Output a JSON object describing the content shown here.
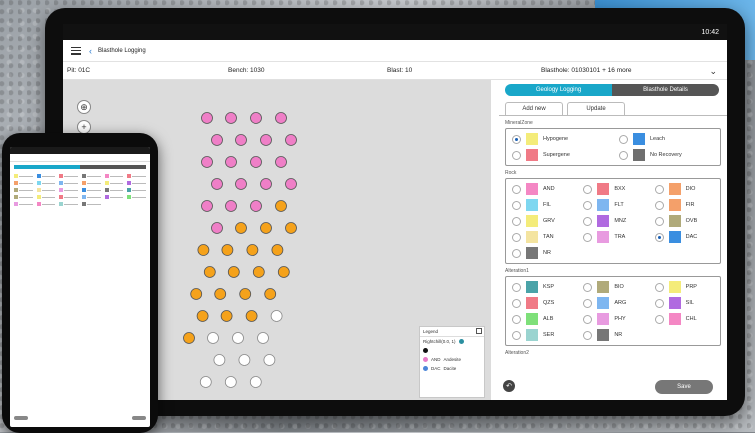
{
  "tablet": {
    "status_time": "10:42",
    "app_title": "Blasthole Logging",
    "info": {
      "pit": "Pit: 01C",
      "bench": "Bench: 1030",
      "blast": "Blast: 10",
      "blasthole": "Blasthole: 01030101 + 16 more"
    },
    "map": {
      "recenter_icon": "target-icon",
      "zoom_in_label": "+",
      "legend": {
        "title": "Legend",
        "subtitle": "Rightchill(0.0, 1)",
        "items": [
          {
            "code": "AND",
            "name": "Andesite",
            "color": "#e87bc8"
          },
          {
            "code": "DAC",
            "name": "Dacite",
            "color": "#4c86d8"
          }
        ]
      }
    },
    "panel": {
      "tabs_top": [
        "Geology Logging",
        "Blasthole Details"
      ],
      "tabs_sub": [
        "Add new",
        "Update"
      ],
      "mineralzone": {
        "label": "MineralZone",
        "options": [
          {
            "name": "Hypogene",
            "color": "#f4ec7a",
            "selected": true
          },
          {
            "name": "Leach",
            "color": "#3a8ee0",
            "selected": false
          },
          {
            "name": "Supergene",
            "color": "#f07a86",
            "selected": false
          },
          {
            "name": "No Recovery",
            "color": "#6f6f6f",
            "selected": false
          }
        ]
      },
      "rock": {
        "label": "Rock",
        "options": [
          {
            "name": "AND",
            "color": "#f487c4",
            "selected": false
          },
          {
            "name": "BXX",
            "color": "#f07a86",
            "selected": false
          },
          {
            "name": "DIO",
            "color": "#f4a06a",
            "selected": false
          },
          {
            "name": "FIL",
            "color": "#7ed7f0",
            "selected": false
          },
          {
            "name": "FLT",
            "color": "#7eb6f0",
            "selected": false
          },
          {
            "name": "FIR",
            "color": "#f4a06a",
            "selected": false
          },
          {
            "name": "GRV",
            "color": "#f4ec7a",
            "selected": false
          },
          {
            "name": "MNZ",
            "color": "#b06ae0",
            "selected": false
          },
          {
            "name": "OVB",
            "color": "#b0aa7a",
            "selected": false
          },
          {
            "name": "TAN",
            "color": "#f4e4a0",
            "selected": false
          },
          {
            "name": "TRA",
            "color": "#e89be0",
            "selected": false
          },
          {
            "name": "DAC",
            "color": "#3a8ee0",
            "selected": true
          },
          {
            "name": "NR",
            "color": "#777777",
            "selected": false
          }
        ]
      },
      "alteration1": {
        "label": "Alteration1",
        "options": [
          {
            "name": "KSP",
            "color": "#4aa3a8",
            "selected": false
          },
          {
            "name": "BIO",
            "color": "#b0aa7a",
            "selected": false
          },
          {
            "name": "PRP",
            "color": "#f4ec7a",
            "selected": false
          },
          {
            "name": "QZS",
            "color": "#f07a86",
            "selected": false
          },
          {
            "name": "ARG",
            "color": "#7eb6f0",
            "selected": false
          },
          {
            "name": "SIL",
            "color": "#b06ae0",
            "selected": false
          },
          {
            "name": "ALB",
            "color": "#7ee07a",
            "selected": false
          },
          {
            "name": "PHY",
            "color": "#e89be0",
            "selected": false
          },
          {
            "name": "CHL",
            "color": "#f487c4",
            "selected": false
          },
          {
            "name": "SER",
            "color": "#9ad4d0",
            "selected": false
          },
          {
            "name": "NR",
            "color": "#777777",
            "selected": false
          }
        ]
      },
      "alteration2_label": "Alteration2",
      "save_label": "Save",
      "back_label": "↶"
    }
  },
  "colors": {
    "accent": "#19a7c9",
    "pink_hole": "#ef7fc7",
    "orange_hole": "#f5a21b",
    "empty_hole": "#ffffff"
  },
  "icons": [
    "hamburger-menu-icon",
    "back-chevron-icon",
    "chevron-down-icon",
    "target-icon",
    "zoom-in-icon",
    "radio-button-icon",
    "back-arrow-icon",
    "phone-device-icon"
  ]
}
